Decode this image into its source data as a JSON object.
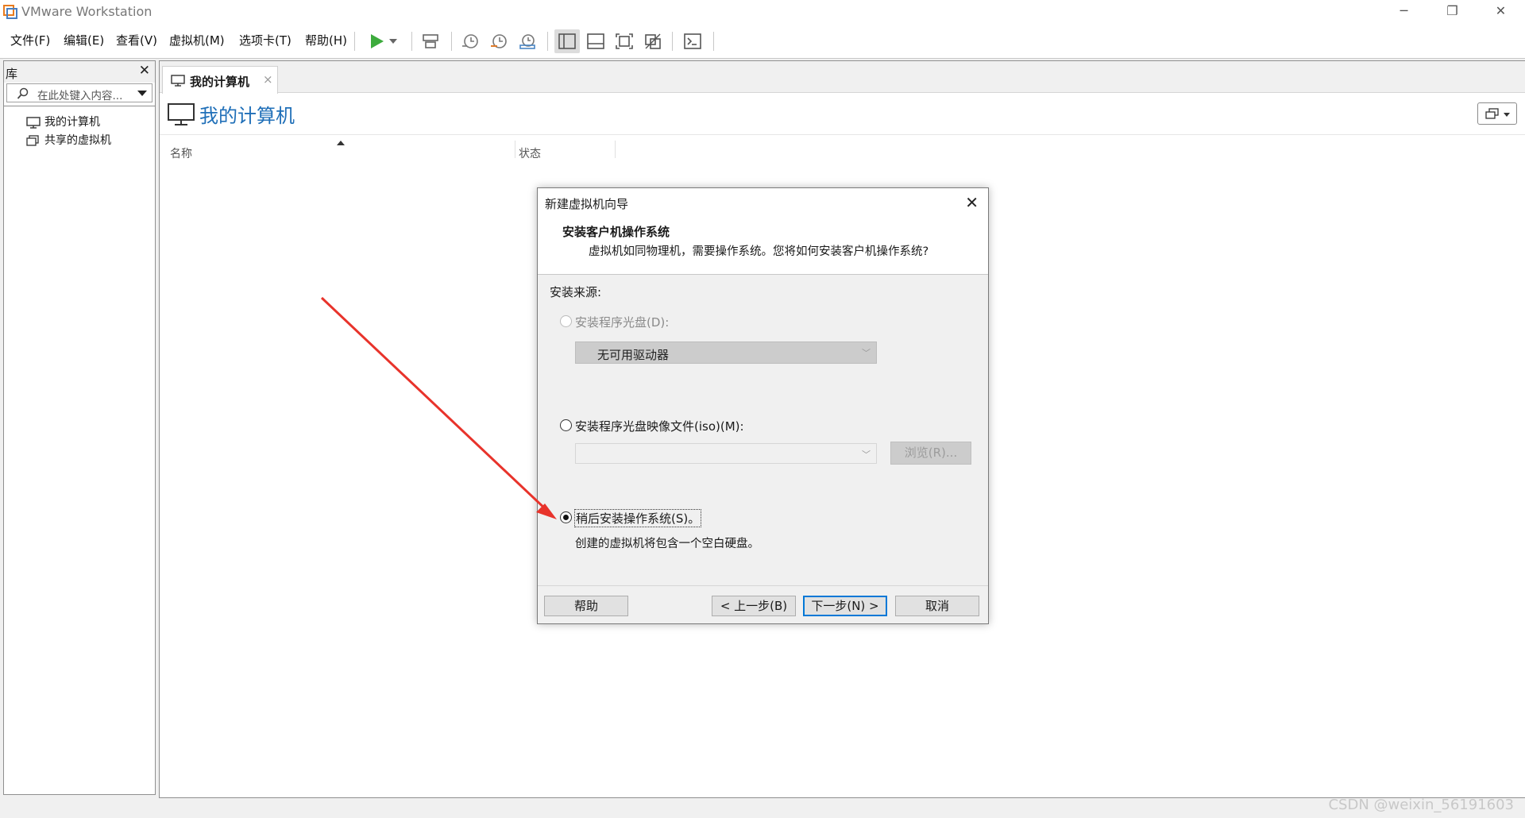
{
  "app": {
    "title": "VMware Workstation",
    "window_controls": {
      "minimize": "─",
      "restore": "❐",
      "close": "✕"
    }
  },
  "menu": [
    {
      "key": "file",
      "label": "文件(F)"
    },
    {
      "key": "edit",
      "label": "编辑(E)"
    },
    {
      "key": "view",
      "label": "查看(V)"
    },
    {
      "key": "vm",
      "label": "虚拟机(M)"
    },
    {
      "key": "tabs",
      "label": "选项卡(T)"
    },
    {
      "key": "help",
      "label": "帮助(H)"
    }
  ],
  "toolbar": {
    "icons": [
      "play-icon",
      "dropdown-arrow-icon",
      "send-ctrl-alt-del-icon",
      "snapshot-icon",
      "revert-snapshot-icon",
      "snapshot-manager-icon",
      "show-library-icon",
      "thumbnail-bar-icon",
      "fullscreen-icon",
      "unity-icon",
      "console-view-icon"
    ]
  },
  "library": {
    "title": "库",
    "close": "✕",
    "search_placeholder": "在此处键入内容...",
    "items": [
      {
        "label": "我的计算机",
        "icon": "computer-icon"
      },
      {
        "label": "共享的虚拟机",
        "icon": "shared-vms-icon"
      }
    ]
  },
  "main": {
    "tab": {
      "label": "我的计算机",
      "close": "×"
    },
    "page_title": "我的计算机",
    "columns": [
      "名称",
      "状态"
    ]
  },
  "dialog": {
    "title": "新建虚拟机向导",
    "close": "✕",
    "heading": "安装客户机操作系统",
    "subheading": "虚拟机如同物理机，需要操作系统。您将如何安装客户机操作系统?",
    "source_label": "安装来源:",
    "options": [
      {
        "label": "安装程序光盘(D):",
        "enabled": false,
        "checked": false
      },
      {
        "label": "安装程序光盘映像文件(iso)(M):",
        "enabled": true,
        "checked": false
      },
      {
        "label": "稍后安装操作系统(S)。",
        "enabled": true,
        "checked": true
      }
    ],
    "drive_select": {
      "value": "无可用驱动器"
    },
    "iso_select": {
      "value": ""
    },
    "browse_button": "浏览(R)...",
    "later_description": "创建的虚拟机将包含一个空白硬盘。",
    "buttons": {
      "help": "帮助",
      "back": "< 上一步(B)",
      "next": "下一步(N) >",
      "cancel": "取消"
    }
  },
  "annotation": {
    "arrow_color": "#e8332b"
  },
  "watermark": "CSDN @weixin_56191603"
}
